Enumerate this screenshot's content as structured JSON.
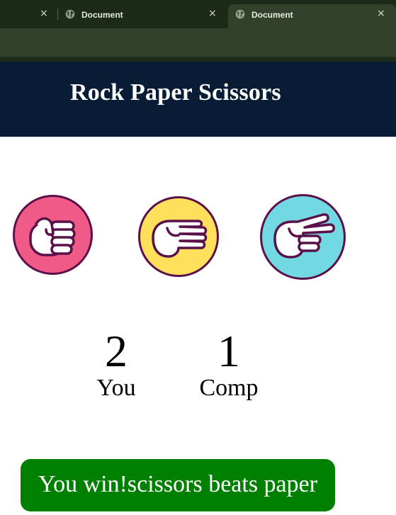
{
  "browser": {
    "tabs": [
      {
        "label": "",
        "active": false
      },
      {
        "label": "Document",
        "active": false
      },
      {
        "label": "Document",
        "active": true
      }
    ],
    "close_glyph": "×"
  },
  "game": {
    "title": "Rock Paper Scissors",
    "choices": [
      {
        "name": "rock",
        "icon": "fist-icon",
        "color": "#ef5b86"
      },
      {
        "name": "paper",
        "icon": "open-hand-icon",
        "color": "#ffe05c"
      },
      {
        "name": "scissors",
        "icon": "two-fingers-icon",
        "color": "#72d9e3"
      }
    ],
    "scores": {
      "user": {
        "value": "2",
        "label": "You"
      },
      "comp": {
        "value": "1",
        "label": "Comp"
      }
    },
    "result": "You win!scissors beats paper",
    "result_color": "#008000"
  },
  "colors": {
    "header_bg": "#081c35",
    "icon_outline": "#5a1149"
  }
}
